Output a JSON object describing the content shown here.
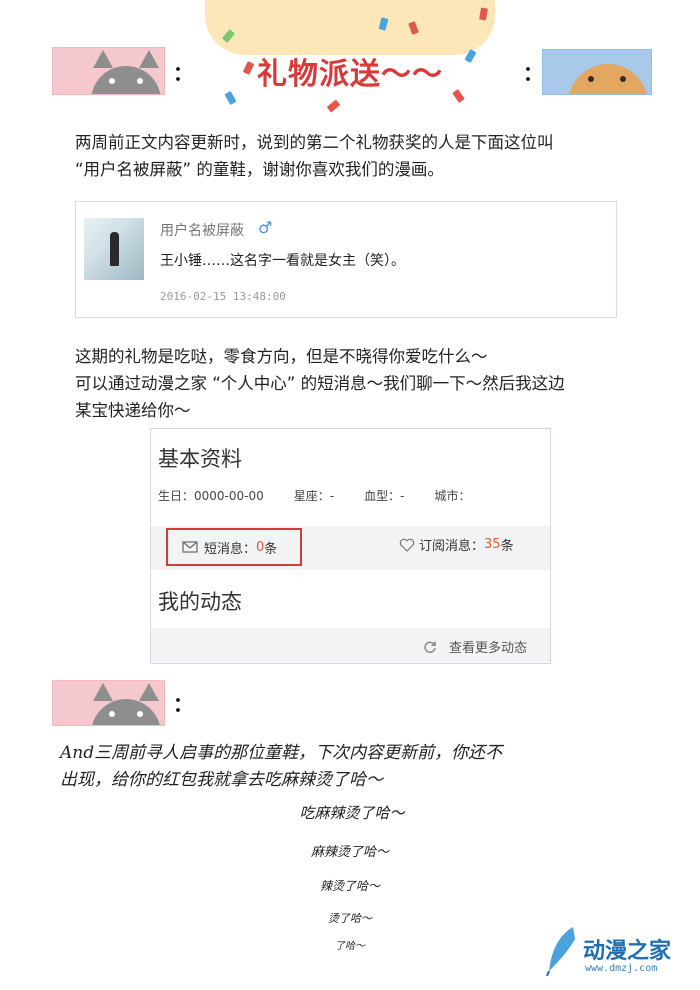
{
  "header": {
    "title": "礼物派送～～"
  },
  "intro": {
    "colon_left": "：",
    "colon_right": "：",
    "line1": "两周前正文内容更新时，说到的第二个礼物获奖的人是下面这位叫",
    "line2": "“用户名被屏蔽” 的童鞋，谢谢你喜欢我们的漫画。"
  },
  "comment": {
    "username": "用户名被屏蔽",
    "gender_icon": "male-icon",
    "text": "王小锤……这名字一看就是女主（笑）。",
    "datetime": "2016-02-15 13:48:00"
  },
  "gift_text": {
    "line1": "这期的礼物是吃哒，零食方向，但是不晓得你爱吃什么～",
    "line2": "可以通过动漫之家 “个人中心” 的短消息～我们聊一下～然后我这边",
    "line3": "某宝快递给你～"
  },
  "profile": {
    "title": "基本资料",
    "birthday": "生日：0000-00-00",
    "constellation": "星座：-",
    "blood": "血型：-",
    "city": "城市：",
    "msg_label": "短消息：",
    "msg_count": "0",
    "msg_unit": "条",
    "sub_label": "订阅消息：",
    "sub_count": "35",
    "sub_unit": "条",
    "activity_title": "我的动态",
    "more_label": "查看更多动态"
  },
  "closing": {
    "colon": "：",
    "line1": "And三周前寻人启事的那位童鞋，下次内容更新前，你还不",
    "line2": "出现，给你的红包我就拿去吃麻辣烫了哈～",
    "fade1": "吃麻辣烫了哈～",
    "fade2": "麻辣烫了哈～",
    "fade3": "辣烫了哈～",
    "fade4": "烫了哈～",
    "fade5": "了哈～"
  },
  "logo": {
    "name": "动漫之家",
    "url": "www.dmzj.com"
  },
  "colors": {
    "title_red": "#d83a3a",
    "highlight_red": "#d43c3c",
    "count_orange": "#e25b36",
    "logo_blue": "#1f6fb0"
  }
}
